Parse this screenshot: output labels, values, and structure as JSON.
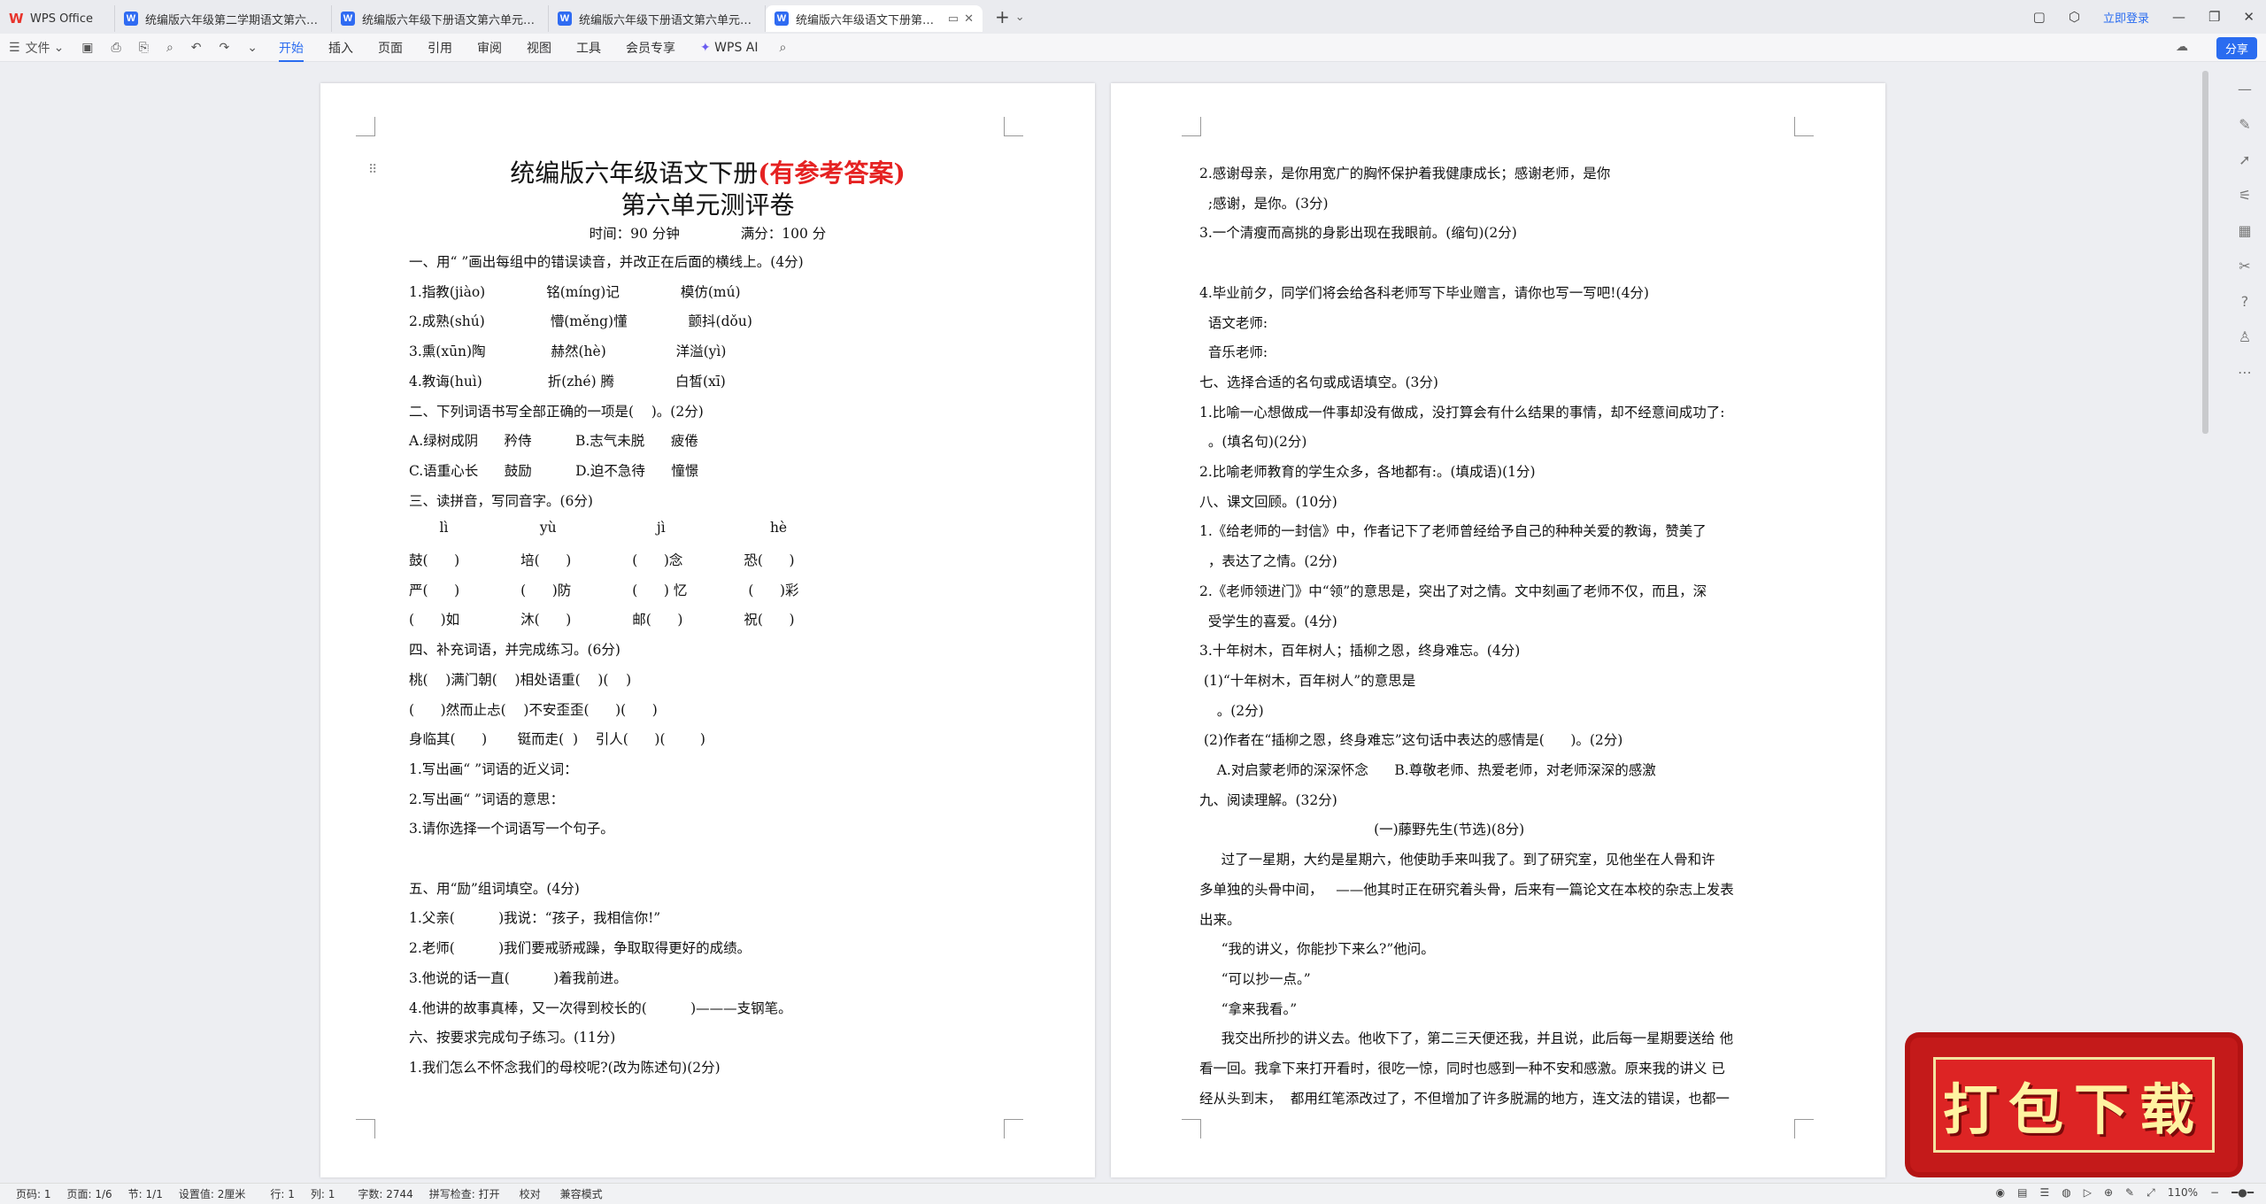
{
  "app": {
    "brand": "WPS Office",
    "tabs": [
      {
        "label": "统编版六年级第二学期语文第六单元"
      },
      {
        "label": "统编版六年级下册语文第六单元达标"
      },
      {
        "label": "统编版六年级下册语文第六单元综合"
      },
      {
        "label": "统编版六年级语文下册第六单"
      }
    ],
    "login": "立即登录",
    "share": "分享"
  },
  "toolbar": {
    "file": "文件",
    "menus": [
      "开始",
      "插入",
      "页面",
      "引用",
      "审阅",
      "视图",
      "工具",
      "会员专享"
    ],
    "ai": "WPS AI"
  },
  "page1": {
    "title_main": "统编版六年级语文下册",
    "title_red": "(有参考答案)",
    "subtitle": "第六单元测评卷",
    "meta": "时间：90 分钟              满分：100 分",
    "lines": [
      "一、用“ ”画出每组中的错误读音，并改正在后面的横线上。(4分)",
      "1.指教(jiào)              铭(míng)记              模仿(mú)",
      "2.成熟(shú)               懵(měng)懂              颤抖(dǒu)",
      "3.熏(xūn)陶               赫然(hè)                洋溢(yì)",
      "4.教诲(huì)               折(zhé) 腾              白皙(xī)",
      "二、下列词语书写全部正确的一项是(    )。(2分)",
      "A.绿树成阴      矜侍          B.志气未脱      疲倦",
      "C.语重心长      鼓励          D.迫不急待      憧憬",
      "三、读拼音，写同音字。(6分)",
      "       lì                     yù                       jì                        hè",
      "鼓(      )              培(      )              (      )念              恐(      )",
      "严(      )              (      )防              (      ) 忆              (      )彩",
      "(      )如              沐(      )              邮(      )              祝(      )",
      "四、补充词语，并完成练习。(6分)",
      "桃(    )满门朝(    )相处语重(    )(    )",
      "(      )然而止忐(    )不安歪歪(      )(      )",
      "身临其(      )       铤而走(  )    引人(      )(        )",
      "1.写出画“ ”词语的近义词：",
      "2.写出画“ ”词语的意思：",
      "3.请你选择一个词语写一个句子。",
      "",
      "五、用“励”组词填空。(4分)",
      "1.父亲(          )我说：“孩子，我相信你!”",
      "2.老师(          )我们要戒骄戒躁，争取取得更好的成绩。",
      "3.他说的话一直(          )着我前进。",
      "4.他讲的故事真棒，又一次得到校长的(          )———支钢笔。",
      "六、按要求完成句子练习。(11分)",
      "1.我们怎么不怀念我们的母校呢?(改为陈述句)(2分)"
    ]
  },
  "page2": {
    "lines": [
      "2.感谢母亲，是你用宽广的胸怀保护着我健康成长；感谢老师，是你",
      "  ;感谢，是你。(3分)",
      "3.一个清瘦而高挑的身影出现在我眼前。(缩句)(2分)",
      "",
      "4.毕业前夕，同学们将会给各科老师写下毕业赠言，请你也写一写吧!(4分)",
      "  语文老师:",
      "  音乐老师:",
      "七、选择合适的名句或成语填空。(3分)",
      "1.比喻一心想做成一件事却没有做成，没打算会有什么结果的事情，却不经意间成功了:",
      "  。(填名句)(2分)",
      "2.比喻老师教育的学生众多，各地都有:。(填成语)(1分)",
      "八、课文回顾。(10分)",
      "1.《给老师的一封信》中，作者记下了老师曾经给予自己的种种关爱的教诲，赞美了",
      "  ，表达了之情。(2分)",
      "2.《老师领进门》中“领”的意思是，突出了对之情。文中刻画了老师不仅，而且，深",
      "  受学生的喜爱。(4分)",
      "3.十年树木，百年树人；插柳之恩，终身难忘。(4分)",
      " (1)“十年树木，百年树人”的意思是",
      "    。(2分)",
      " (2)作者在“插柳之恩，终身难忘”这句话中表达的感情是(      )。(2分)",
      "    A.对启蒙老师的深深怀念      B.尊敬老师、热爱老师，对老师深深的感激",
      "九、阅读理解。(32分)",
      "                                        (一)藤野先生(节选)(8分)",
      "     过了一星期，大约是星期六，他使助手来叫我了。到了研究室，见他坐在人骨和许",
      "多单独的头骨中间，   ——他其时正在研究着头骨，后来有一篇论文在本校的杂志上发表",
      "出来。",
      "     “我的讲义，你能抄下来么?”他问。",
      "     “可以抄一点。”",
      "     “拿来我看。”",
      "     我交出所抄的讲义去。他收下了，第二三天便还我，并且说，此后每一星期要送给 他",
      "看一回。我拿下来打开看时，很吃一惊，同时也感到一种不安和感激。原来我的讲义 已",
      "经从头到末，  都用红笔添改过了，不但增加了许多脱漏的地方，连文法的错误，也都一"
    ]
  },
  "status": {
    "page": "页码: 1",
    "pages": "页面: 1/6",
    "section": "节: 1/1",
    "setting": "设置值: 2厘米",
    "row": "行: 1",
    "col": "列: 1",
    "words": "字数: 2744",
    "spell": "拼写检查: 打开",
    "proof": "校对",
    "compat": "兼容模式",
    "zoom": "110%"
  },
  "banner": {
    "text": "打包下载"
  }
}
